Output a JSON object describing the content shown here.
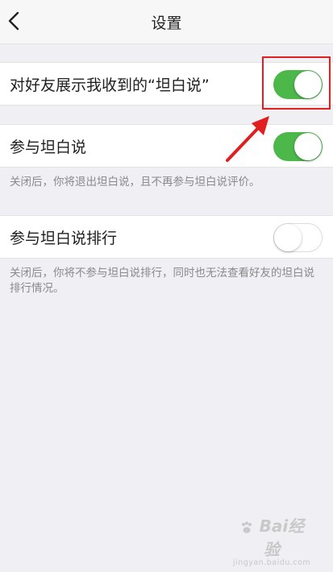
{
  "header": {
    "title": "设置",
    "back_icon": "chevron-left-icon"
  },
  "settings": [
    {
      "label": "对好友展示我收到的“坦白说”",
      "enabled": true,
      "hint": ""
    },
    {
      "label": "参与坦白说",
      "enabled": true,
      "hint": "关闭后，你将退出坦白说，且不再参与坦白说评价。"
    },
    {
      "label": "参与坦白说排行",
      "enabled": false,
      "hint": "关闭后，你将不参与坦白说排行，同时也无法查看好友的坦白说排行情况。"
    }
  ],
  "annotation": {
    "highlight_color": "#e02020"
  },
  "watermark": {
    "logo": "Bai经验",
    "url": "jingyan.baidu.com"
  },
  "colors": {
    "toggle_on": "#4cb84a",
    "toggle_off": "#ffffff",
    "background": "#efeff4"
  }
}
